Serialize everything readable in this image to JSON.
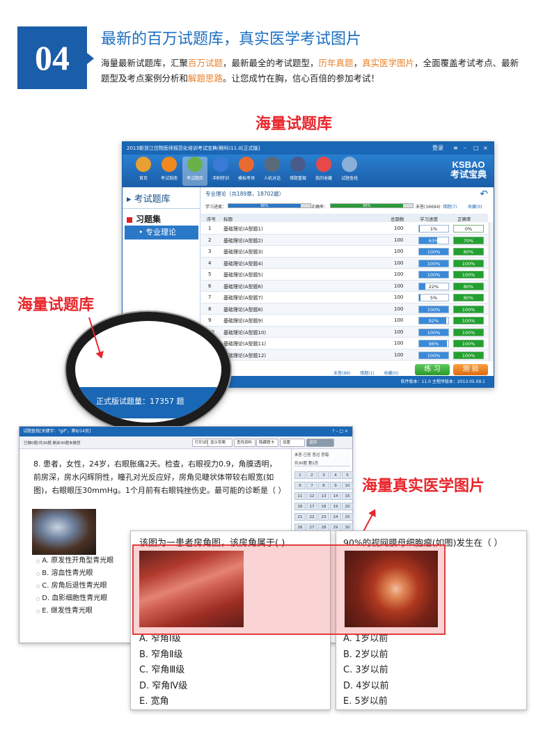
{
  "header": {
    "number": "04",
    "title": "最新的百万试题库，真实医学考试图片",
    "desc_parts": [
      {
        "text": "海量最新试题库，汇聚",
        "hl": false
      },
      {
        "text": "百万试题",
        "hl": true
      },
      {
        "text": "，最新最全的考试题型，",
        "hl": false
      },
      {
        "text": "历年真题",
        "hl": true
      },
      {
        "text": "，",
        "hl": false
      },
      {
        "text": "真实医学图片",
        "hl": true
      },
      {
        "text": "，全面覆盖考试考点、最新题型及考点案例分析和",
        "hl": false
      },
      {
        "text": "解题思路",
        "hl": true
      },
      {
        "text": "。让您成竹在胸，信心百倍的参加考试！",
        "hl": false
      }
    ]
  },
  "labels": {
    "bank_top": "海量试题库",
    "bank_left": "海量试题库",
    "images": "海量真实医学图片"
  },
  "window": {
    "title": "2013新浙江住院医师规范化培训考试宝典(眼科)11.0[正式版]",
    "login": "登录",
    "toolbar": [
      {
        "label": "首页",
        "icon": "home-icon",
        "color": "#e8a030"
      },
      {
        "label": "考试指南",
        "icon": "compass-icon",
        "color": "#f08a20"
      },
      {
        "label": "考试题库",
        "icon": "books-icon",
        "color": "#6ab04a"
      },
      {
        "label": "冲刺特训",
        "icon": "globe-icon",
        "color": "#3a7ad8"
      },
      {
        "label": "模拟考场",
        "icon": "clock-icon",
        "color": "#e86a30"
      },
      {
        "label": "人机对话",
        "icon": "chess-icon",
        "color": "#5a6a7a"
      },
      {
        "label": "错题重做",
        "icon": "pen-icon",
        "color": "#4a5a8a"
      },
      {
        "label": "我的收藏",
        "icon": "gift-icon",
        "color": "#e84a4a"
      },
      {
        "label": "试题查找",
        "icon": "magnifier-icon",
        "color": "#8ab0d8"
      }
    ],
    "logo_top": "KSBAO",
    "logo_bottom": "考试宝典",
    "sidebar": {
      "heading": "考试题库",
      "group": "习题集",
      "item": "专业理论"
    },
    "pane_title": "专业理论（共189章，18702题）",
    "progress": {
      "study_label": "学习进度：",
      "study_value": "88%",
      "study_pct": 88,
      "correct_label": "正确率：",
      "correct_value": "88%",
      "correct_pct": 88
    },
    "right_links": {
      "unanswered": "未答(16694)",
      "wrong": "错题(7)",
      "fav": "收藏(0)"
    },
    "columns": [
      "序号",
      "标题",
      "总题数",
      "学习进度",
      "正确率"
    ],
    "rows": [
      {
        "no": "1",
        "title": "基础理论(A型题1)",
        "total": "100",
        "progress": "1%",
        "pct": 1,
        "rate": "0%",
        "rate_pct": 0
      },
      {
        "no": "2",
        "title": "基础理论(A型题2)",
        "total": "100",
        "progress": "63%",
        "pct": 63,
        "rate": "70%",
        "rate_pct": 70
      },
      {
        "no": "3",
        "title": "基础理论(A型题3)",
        "total": "100",
        "progress": "100%",
        "pct": 100,
        "rate": "80%",
        "rate_pct": 80
      },
      {
        "no": "4",
        "title": "基础理论(A型题4)",
        "total": "100",
        "progress": "100%",
        "pct": 100,
        "rate": "100%",
        "rate_pct": 100
      },
      {
        "no": "5",
        "title": "基础理论(A型题5)",
        "total": "100",
        "progress": "100%",
        "pct": 100,
        "rate": "100%",
        "rate_pct": 100
      },
      {
        "no": "6",
        "title": "基础理论(A型题6)",
        "total": "100",
        "progress": "22%",
        "pct": 22,
        "rate": "80%",
        "rate_pct": 80
      },
      {
        "no": "7",
        "title": "基础理论(A型题7)",
        "total": "100",
        "progress": "5%",
        "pct": 5,
        "rate": "80%",
        "rate_pct": 80
      },
      {
        "no": "8",
        "title": "基础理论(A型题8)",
        "total": "100",
        "progress": "100%",
        "pct": 100,
        "rate": "100%",
        "rate_pct": 100
      },
      {
        "no": "9",
        "title": "基础理论(A型题9)",
        "total": "100",
        "progress": "92%",
        "pct": 92,
        "rate": "100%",
        "rate_pct": 100
      },
      {
        "no": "10",
        "title": "基础理论(A型题10)",
        "total": "100",
        "progress": "100%",
        "pct": 100,
        "rate": "100%",
        "rate_pct": 100
      },
      {
        "no": "11",
        "title": "基础理论(A型题11)",
        "total": "100",
        "progress": "96%",
        "pct": 96,
        "rate": "100%",
        "rate_pct": 100
      },
      {
        "no": "12",
        "title": "基础理论(A型题12)",
        "total": "100",
        "progress": "100%",
        "pct": 100,
        "rate": "100%",
        "rate_pct": 100
      }
    ],
    "footer_links": {
      "unanswered": "未答(99)",
      "wrong": "错题(1)",
      "fav": "收藏(0)"
    },
    "btn_practice": "练 习",
    "btn_test": "测 验",
    "status": "软件版本：11.0  主程序版本：2013.05.09.1"
  },
  "lens": {
    "text": "正式版试题量：17357 题"
  },
  "search_window": {
    "title": "试题查找[关键字：\"gif\"，第6/14页]",
    "info": "已做0题/共30题  剩余30题未做答",
    "buttons": [
      "打印试题",
      "显示答案",
      "查找资料",
      "隐藏题卡",
      "设置",
      "返回"
    ],
    "question": "8. 患者，女性，24岁，右眼胀痛2天。检查，右眼视力0.9，角膜透明，前房深，房水闪辉阴性，瞳孔对光反应好，房角见睫状体带较右眼宽(如图)，右眼眼压30mmHg。1个月前有右眼钝挫伤史。最可能的诊断是（ ）",
    "options": [
      "A. 原发性开角型青光眼",
      "B. 溶血性青光眼",
      "C. 房角后退性青光眼",
      "D. 血影细胞性青光眼",
      "E. 继发性青光眼"
    ],
    "panel_legend": "未答  已答  答过  答错",
    "panel_page": "共30题  第1页"
  },
  "card1": {
    "question": "该图为一患者房角图，该房角属于(    )",
    "options": [
      "A. 窄角Ⅰ级",
      "B. 窄角Ⅱ级",
      "C. 窄角Ⅲ级",
      "D. 窄角Ⅳ级",
      "E. 宽角"
    ]
  },
  "card2": {
    "question": "90%的视网膜母细胞瘤(如图)发生在（ ）",
    "options": [
      "A. 1岁以前",
      "B. 2岁以前",
      "C. 3岁以前",
      "D. 4岁以前",
      "E. 5岁以前"
    ]
  }
}
